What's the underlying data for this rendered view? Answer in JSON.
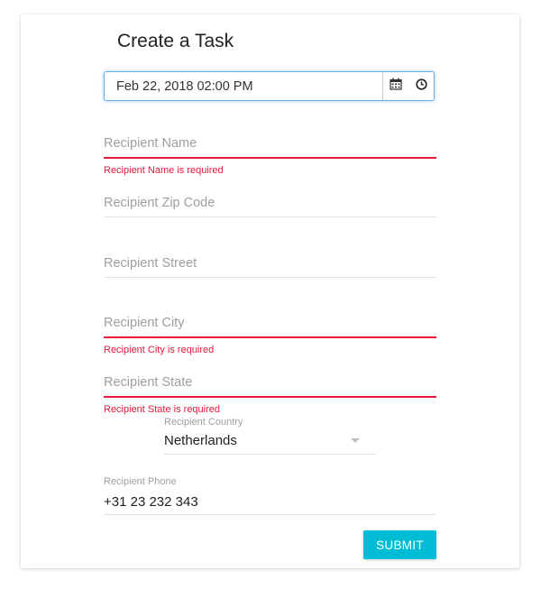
{
  "form": {
    "title": "Create a Task",
    "datetime": {
      "value": "Feb 22, 2018 02:00 PM"
    },
    "name": {
      "placeholder": "Recipient Name",
      "error": "Recipient Name is required"
    },
    "zip": {
      "placeholder": "Recipient Zip Code"
    },
    "street": {
      "placeholder": "Recipient Street"
    },
    "city": {
      "placeholder": "Recipient City",
      "error": "Recipient City is required"
    },
    "state": {
      "placeholder": "Recipient State",
      "error": "Recipient State is required"
    },
    "country": {
      "label": "Recipient Country",
      "value": "Netherlands"
    },
    "phone": {
      "label": "Recipient Phone",
      "value": "+31 23 232 343"
    },
    "submit_label": "SUBMIT"
  },
  "icons": {
    "calendar": "calendar-icon",
    "clock": "clock-icon",
    "dropdown": "chevron-down-icon"
  },
  "colors": {
    "accent": "#00bcd4",
    "error": "#e8173b",
    "focus": "#66afe9"
  }
}
